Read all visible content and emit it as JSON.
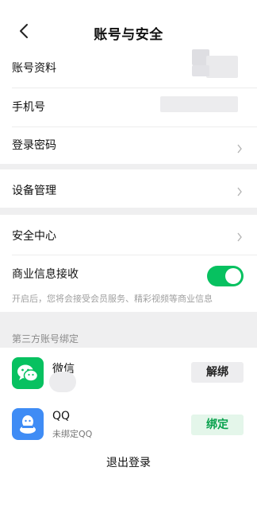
{
  "header": {
    "title": "账号与安全",
    "back_icon": "back-arrow-icon"
  },
  "rows": {
    "account_profile": {
      "label": "账号资料"
    },
    "phone": {
      "label": "手机号"
    },
    "login_password": {
      "label": "登录密码"
    },
    "device_management": {
      "label": "设备管理"
    },
    "security_center": {
      "label": "安全中心"
    },
    "business_info": {
      "label": "商业信息接收",
      "enabled": true,
      "description": "开启后，您将会接受会员服务、精彩视频等商业信息"
    }
  },
  "third_party": {
    "section_title": "第三方账号绑定",
    "wechat": {
      "name": "微信",
      "button": "解绑",
      "icon": "wechat-icon"
    },
    "qq": {
      "name": "QQ",
      "status": "未绑定QQ",
      "button": "绑定",
      "icon": "qq-icon"
    }
  },
  "logout": {
    "label": "退出登录"
  },
  "colors": {
    "accent_green": "#07c160",
    "bind_green": "#07a14c"
  }
}
